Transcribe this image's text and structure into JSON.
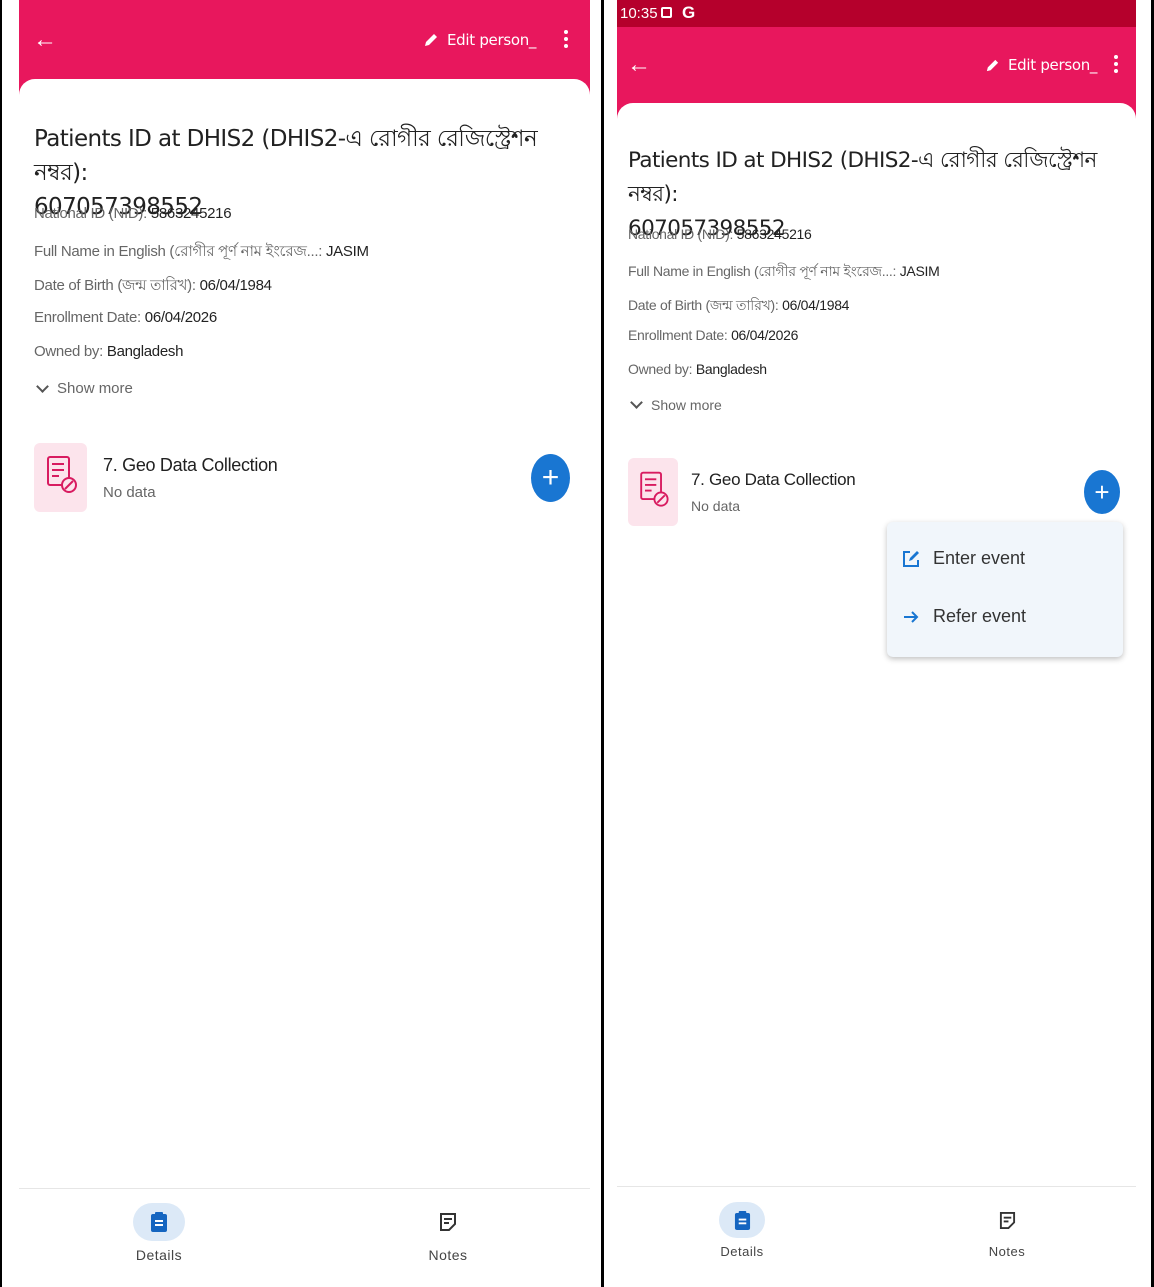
{
  "colors": {
    "appbar": "#e8175d",
    "statusbar": "#b5002c",
    "fab": "#1976d2",
    "stage_icon_bg": "#fce4ec",
    "nav_active_pill": "#dce9f7"
  },
  "status_bar": {
    "time": "10:35"
  },
  "toolbar": {
    "edit_label": "Edit person_"
  },
  "patient": {
    "title": "Patients ID at DHIS2 (DHIS2-এ রোগীর রেজিস্ট্রেশন নম্বর):",
    "id_value": "607057398552",
    "attributes": [
      {
        "label": "National ID (NID):",
        "value": "5863245216"
      },
      {
        "label": "Full Name in English (রোগীর পূর্ণ নাম ইংরেজ...:",
        "value": "JASIM"
      },
      {
        "label": "Date of Birth (জন্ম তারিখ):",
        "value": "06/04/1984"
      },
      {
        "label": "Enrollment Date:",
        "value": "06/04/2026"
      },
      {
        "label": "Owned by:",
        "value": "Bangladesh"
      }
    ],
    "show_more": "Show more"
  },
  "stage": {
    "title": "7. Geo Data Collection",
    "subtitle": "No data"
  },
  "fab_icon": "plus-icon",
  "menu": {
    "items": [
      {
        "label": "Enter event",
        "icon": "edit-box-icon"
      },
      {
        "label": "Refer event",
        "icon": "arrow-right-icon"
      }
    ]
  },
  "nav": {
    "details": "Details",
    "notes": "Notes"
  }
}
